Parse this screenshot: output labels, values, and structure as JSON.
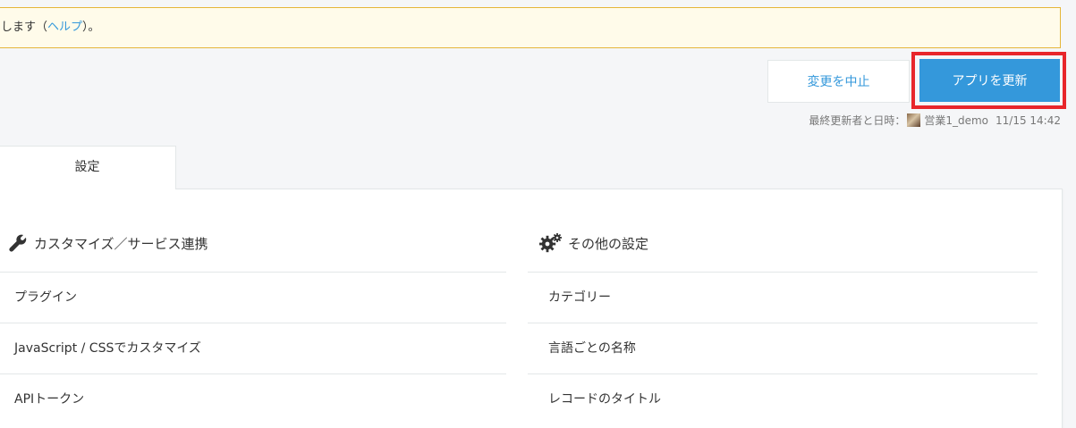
{
  "notice": {
    "text": "します（",
    "help_link": "ヘルプ",
    "tail": "）。"
  },
  "actions": {
    "cancel_label": "変更を中止",
    "update_label": "アプリを更新"
  },
  "last_updated": {
    "label": "最終更新者と日時：",
    "user": "営業1_demo",
    "datetime": "11/15 14:42"
  },
  "tabs": [
    {
      "label": "設定"
    }
  ],
  "sections": [
    {
      "title": "カスタマイズ／サービス連携",
      "icon": "wrench-icon",
      "items": [
        {
          "label": "プラグイン"
        },
        {
          "label": "JavaScript / CSSでカスタマイズ"
        },
        {
          "label": "APIトークン"
        }
      ]
    },
    {
      "title": "その他の設定",
      "icon": "gears-icon",
      "items": [
        {
          "label": "カテゴリー"
        },
        {
          "label": "言語ごとの名称"
        },
        {
          "label": "レコードのタイトル"
        }
      ]
    }
  ],
  "colors": {
    "accent": "#3498db",
    "highlight": "#e8262b",
    "notice_bg": "#fffbea",
    "notice_border": "#e5b63a"
  }
}
